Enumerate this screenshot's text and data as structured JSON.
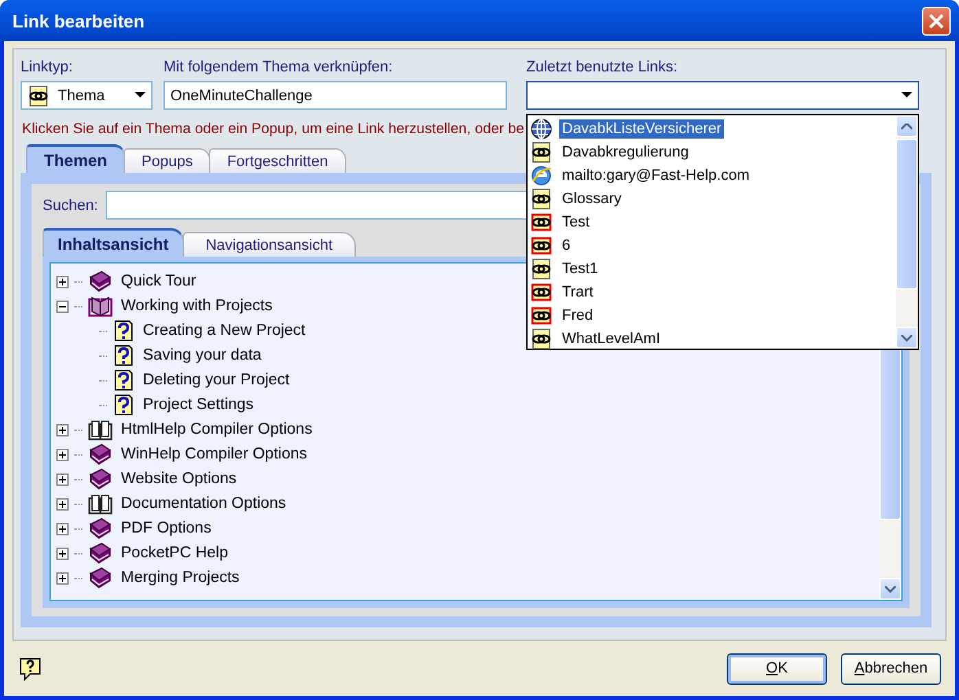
{
  "window": {
    "title": "Link bearbeiten"
  },
  "link_type": {
    "label": "Linktyp:",
    "value": "Thema"
  },
  "topic": {
    "label": "Mit folgendem Thema verknüpfen:",
    "value": "OneMinuteChallenge"
  },
  "recent_links": {
    "label": "Zuletzt benutzte Links:",
    "expanded": true,
    "items": [
      {
        "label": "DavabkListeVersicherer",
        "kind": "globe",
        "selected": true
      },
      {
        "label": "Davabkregulierung",
        "kind": "link",
        "selected": false
      },
      {
        "label": "mailto:gary@Fast-Help.com",
        "kind": "web",
        "selected": false
      },
      {
        "label": "Glossary",
        "kind": "link",
        "selected": false
      },
      {
        "label": "Test",
        "kind": "red-link",
        "selected": false
      },
      {
        "label": "6",
        "kind": "red-link",
        "selected": false
      },
      {
        "label": "Test1",
        "kind": "link",
        "selected": false
      },
      {
        "label": "Trart",
        "kind": "red-link",
        "selected": false
      },
      {
        "label": "Fred",
        "kind": "red-link",
        "selected": false
      },
      {
        "label": "WhatLevelAmI",
        "kind": "link",
        "selected": false
      }
    ]
  },
  "hint": "Klicken Sie auf ein Thema oder ein Popup, um eine Link herzustellen, oder be",
  "tabs": [
    {
      "label": "Themen",
      "selected": true
    },
    {
      "label": "Popups",
      "selected": false
    },
    {
      "label": "Fortgeschritten",
      "selected": false
    }
  ],
  "search": {
    "label": "Suchen:"
  },
  "view_tabs": [
    {
      "label": "Inhaltsansicht",
      "selected": true
    },
    {
      "label": "Navigationsansicht",
      "selected": false
    }
  ],
  "tree": [
    {
      "label": "Quick Tour",
      "kind": "book",
      "expanded": false
    },
    {
      "label": "Working with Projects",
      "kind": "open-book",
      "expanded": true,
      "children": [
        {
          "label": "Creating a New Project",
          "kind": "topic"
        },
        {
          "label": "Saving your data",
          "kind": "topic"
        },
        {
          "label": "Deleting your Project",
          "kind": "topic"
        },
        {
          "label": "Project Settings",
          "kind": "topic"
        }
      ]
    },
    {
      "label": "HtmlHelp Compiler Options",
      "kind": "outline-book",
      "expanded": false
    },
    {
      "label": "WinHelp Compiler Options",
      "kind": "book",
      "expanded": false
    },
    {
      "label": "Website Options",
      "kind": "book",
      "expanded": false
    },
    {
      "label": "Documentation Options",
      "kind": "outline-book",
      "expanded": false
    },
    {
      "label": "PDF Options",
      "kind": "book",
      "expanded": false
    },
    {
      "label": "PocketPC Help",
      "kind": "book",
      "expanded": false
    },
    {
      "label": "Merging Projects",
      "kind": "book",
      "expanded": false
    }
  ],
  "buttons": [
    {
      "label": "OK"
    },
    {
      "label": "Abbrechen"
    }
  ]
}
